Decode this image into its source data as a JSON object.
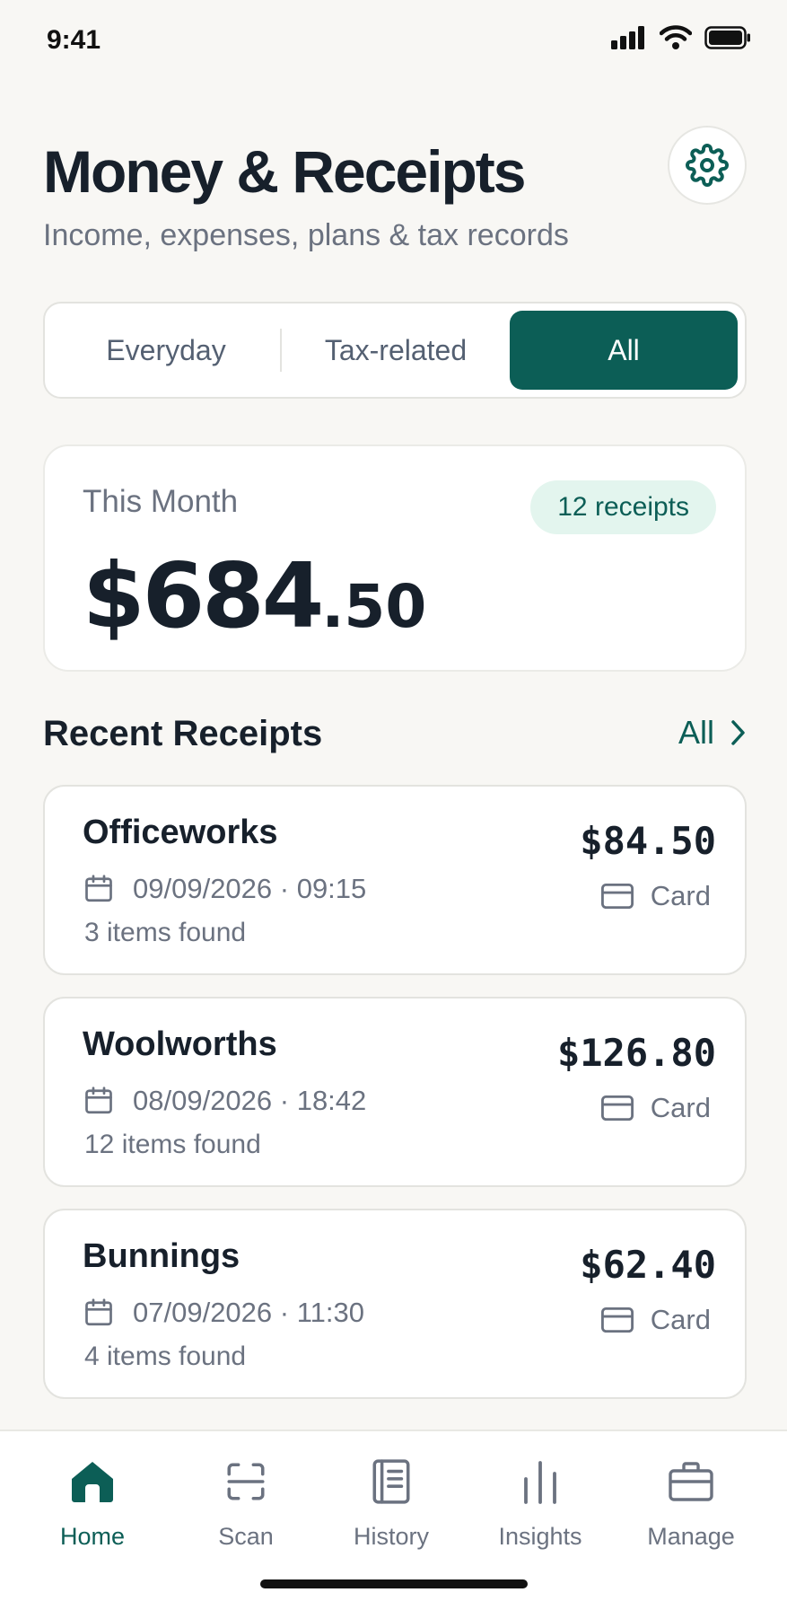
{
  "status": {
    "time": "9:41"
  },
  "header": {
    "title": "Money & Receipts",
    "subtitle": "Income, expenses, plans & tax records"
  },
  "segments": [
    {
      "label": "Everyday",
      "active": false
    },
    {
      "label": "Tax-related",
      "active": false
    },
    {
      "label": "All",
      "active": true
    }
  ],
  "summary": {
    "label": "This Month",
    "badge": "12 receipts",
    "amount_main": "$684",
    "amount_cents": ".50"
  },
  "recent": {
    "title": "Recent Receipts",
    "see_all": "All",
    "items": [
      {
        "merchant": "Officeworks",
        "date": "09/09/2026 · 09:15",
        "items_found": "3 items found",
        "amount": "$84.50",
        "payment": "Card"
      },
      {
        "merchant": "Woolworths",
        "date": "08/09/2026 · 18:42",
        "items_found": "12 items found",
        "amount": "$126.80",
        "payment": "Card"
      },
      {
        "merchant": "Bunnings",
        "date": "07/09/2026 · 11:30",
        "items_found": "4 items found",
        "amount": "$62.40",
        "payment": "Card"
      }
    ]
  },
  "tabs": [
    {
      "label": "Home",
      "icon": "home-icon",
      "active": true
    },
    {
      "label": "Scan",
      "icon": "scan-icon",
      "active": false
    },
    {
      "label": "History",
      "icon": "history-icon",
      "active": false
    },
    {
      "label": "Insights",
      "icon": "insights-icon",
      "active": false
    },
    {
      "label": "Manage",
      "icon": "briefcase-icon",
      "active": false
    }
  ],
  "colors": {
    "accent": "#0c5e56",
    "background": "#f8f7f4",
    "badge_bg": "#e3f5ee",
    "text_primary": "#17202b",
    "text_secondary": "#6b7280"
  }
}
